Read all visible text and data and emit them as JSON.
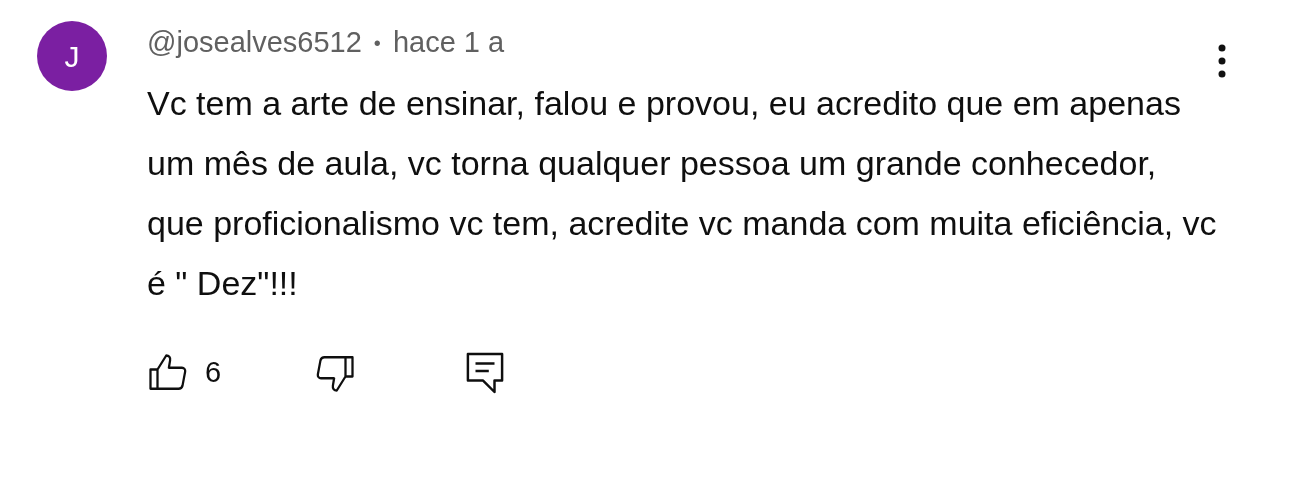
{
  "comment": {
    "avatar_letter": "J",
    "author": "@josealves6512",
    "separator": "•",
    "time": "hace 1 a",
    "text": "Vc tem a arte de ensinar, falou e provou, eu acredito que em apenas um mês de aula, vc torna qualquer pessoa um grande conhecedor, que proficionalismo vc tem, acredite vc manda com muita eficiência, vc é \" Dez\"!!!",
    "likes": "6"
  }
}
